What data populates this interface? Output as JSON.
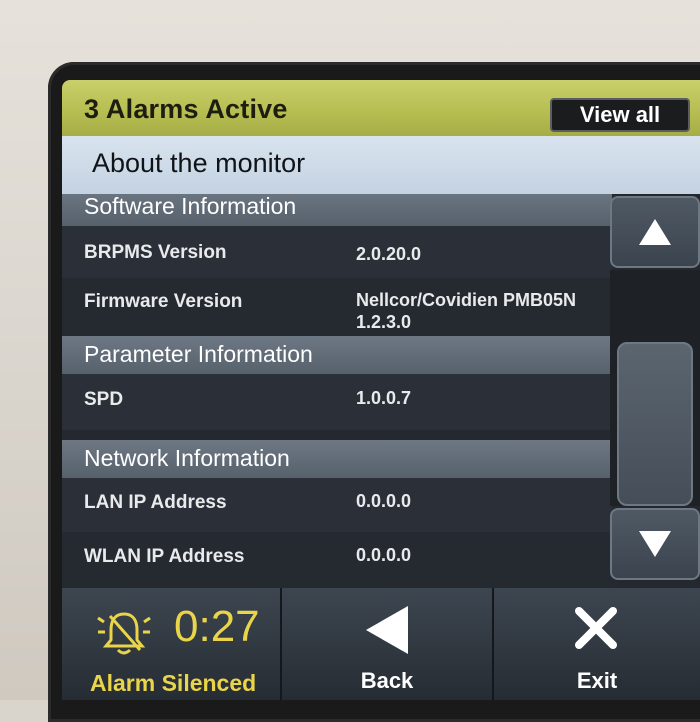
{
  "alarm_bar": {
    "title": "3 Alarms Active",
    "view_all_label": "View all"
  },
  "page": {
    "title": "About the monitor"
  },
  "sections": {
    "software": {
      "header": "Software Information",
      "rows": [
        {
          "label": "BRPMS Version",
          "value": "2.0.20.0"
        },
        {
          "label": "Firmware Version",
          "value": "Nellcor/Covidien PMB05N 1.2.3.0"
        }
      ]
    },
    "parameter": {
      "header": "Parameter Information",
      "rows": [
        {
          "label": "SPD",
          "value": "1.0.0.7"
        }
      ]
    },
    "network": {
      "header": "Network Information",
      "rows": [
        {
          "label": "LAN IP Address",
          "value": "0.0.0.0"
        },
        {
          "label": "WLAN IP Address",
          "value": "0.0.0.0"
        }
      ]
    }
  },
  "scroll": {
    "up_icon": "triangle-up-icon",
    "down_icon": "triangle-down-icon"
  },
  "bottom_bar": {
    "alarm_timer": "0:27",
    "alarm_status": "Alarm Silenced",
    "back_label": "Back",
    "exit_label": "Exit",
    "bell_icon": "alarm-silenced-bell-icon",
    "back_icon": "left-triangle-icon",
    "exit_icon": "x-icon"
  },
  "colors": {
    "alarm_bar": "#b7be52",
    "alarm_text": "#e9d44a",
    "section_header": "#5f6a76",
    "title_bar": "#c8d6e4"
  }
}
